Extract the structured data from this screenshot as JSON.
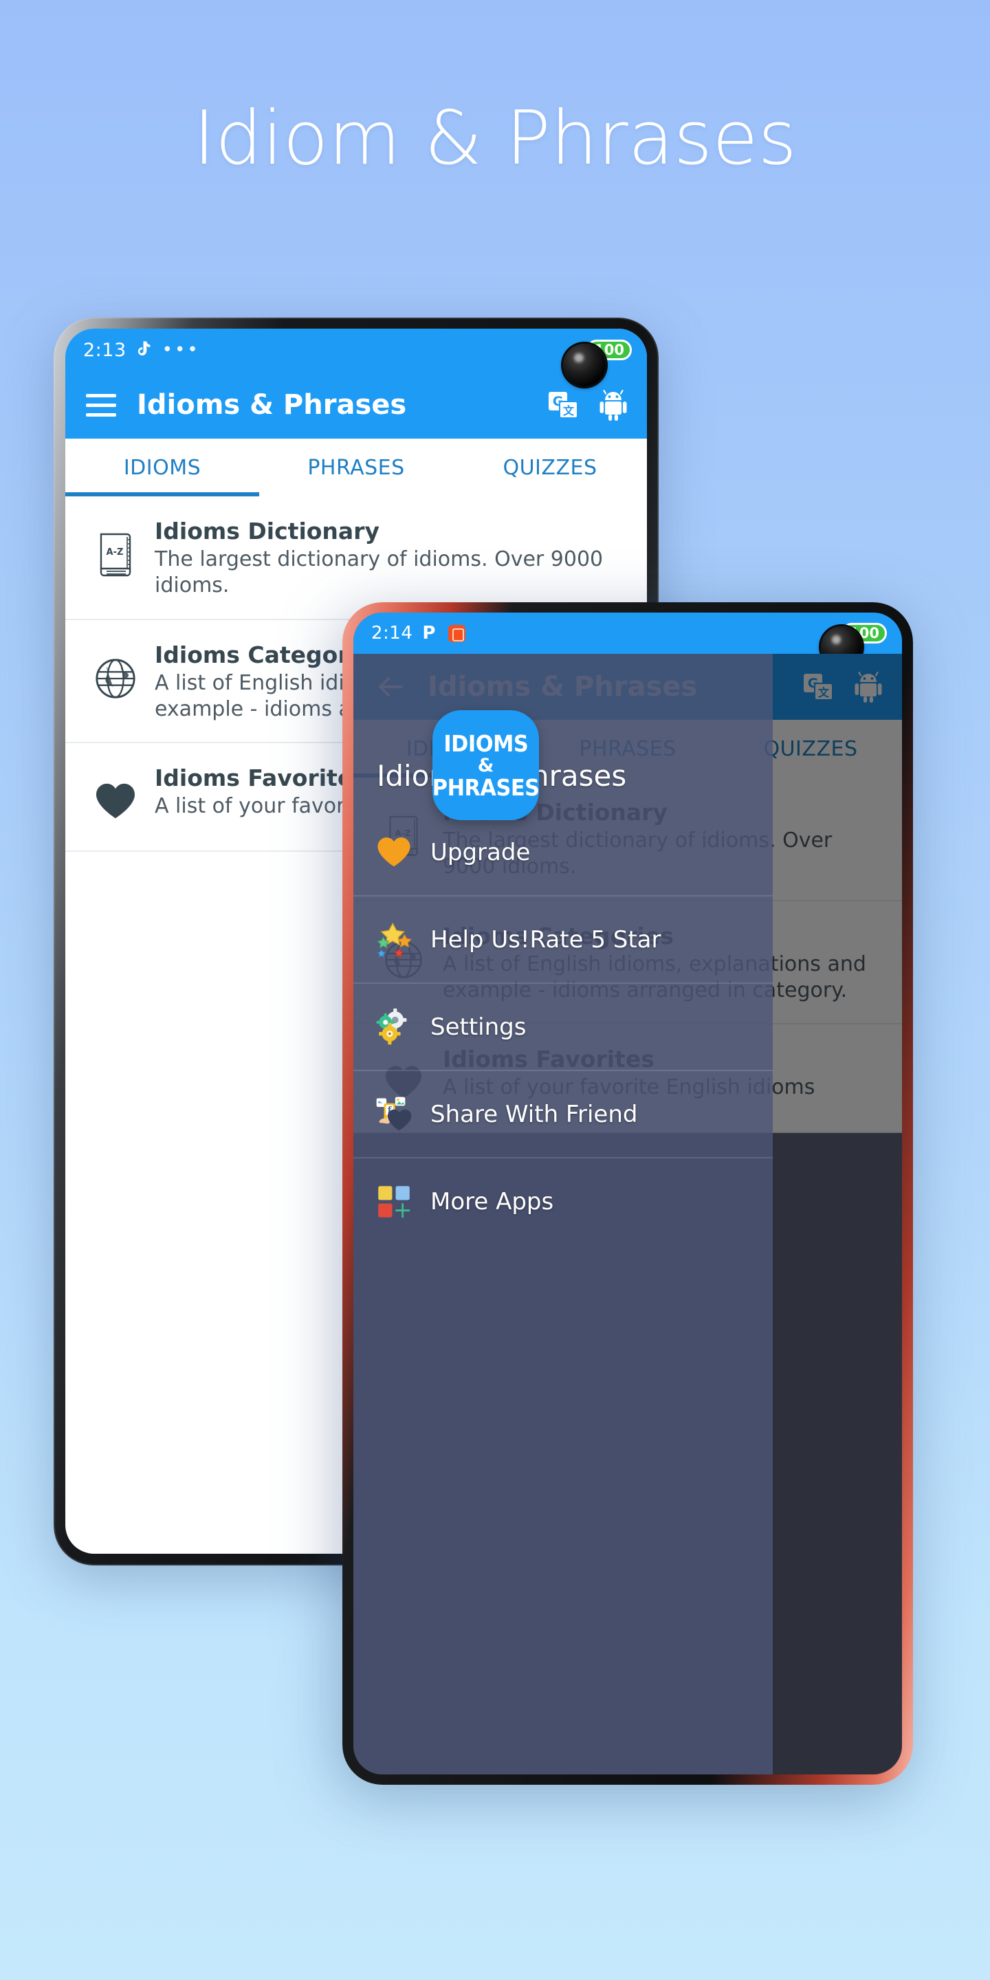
{
  "hero": {
    "title": "Idiom & Phrases"
  },
  "colors": {
    "bg_top": "#9cbffa",
    "bg_bottom": "#c5e8fc",
    "primary_blue": "#1e9bf5",
    "tab_blue": "#1e7fc4",
    "battery_green": "#3ec340",
    "accent_orange": "#f59f1e",
    "frame_front": "#c4422f",
    "frame_back": "#16181b"
  },
  "phone_back": {
    "status": {
      "time": "2:13",
      "icons": [
        "tiktok-icon",
        "more-dots-icon"
      ],
      "battery": "100"
    },
    "appbar": {
      "menu_icon": "hamburger-menu-icon",
      "title": "Idioms & Phrases",
      "actions": [
        "google-translate-icon",
        "android-robot-icon"
      ]
    },
    "tabs": [
      {
        "label": "IDIOMS",
        "selected": true
      },
      {
        "label": "PHRASES",
        "selected": false
      },
      {
        "label": "QUIZZES",
        "selected": false
      }
    ],
    "list": [
      {
        "icon": "az-dictionary-book-icon",
        "title": "Idioms Dictionary",
        "subtitle": "The largest dictionary of idioms. Over 9000 idioms."
      },
      {
        "icon": "globe-icon",
        "title": "Idioms Categories",
        "subtitle": "A list of English idioms, explanations and example - idioms arranged in category."
      },
      {
        "icon": "heart-icon",
        "title": "Idioms Favorites",
        "subtitle": "A list of your favorite English idioms"
      }
    ]
  },
  "phone_front": {
    "status": {
      "time": "2:14",
      "icons": [
        "pinterest-icon",
        "orange-app-icon"
      ],
      "battery": "100"
    },
    "appbar": {
      "back_icon": "back-arrow-icon",
      "title": "Idioms & Phrases",
      "actions": [
        "google-translate-icon",
        "android-robot-icon"
      ]
    },
    "tabs": [
      {
        "label": "IDIOMS",
        "selected": true
      },
      {
        "label": "PHRASES",
        "selected": false
      },
      {
        "label": "QUIZZES",
        "selected": false
      }
    ],
    "list": [
      {
        "icon": "az-dictionary-book-icon",
        "title": "Idioms Dictionary",
        "subtitle": "The largest dictionary of idioms. Over 9000 idioms."
      },
      {
        "icon": "globe-icon",
        "title": "Idioms Categories",
        "subtitle": "A list of English idioms, explanations and example - idioms arranged in category."
      },
      {
        "icon": "heart-icon",
        "title": "Idioms Favorites",
        "subtitle": "A list of your favorite English idioms"
      }
    ],
    "drawer": {
      "header_title": "Idioms & Phrases",
      "items": [
        {
          "icon": "orange-heart-icon",
          "label": "Upgrade"
        },
        {
          "icon": "stars-rating-icon",
          "label": "Help Us!Rate 5 Star"
        },
        {
          "icon": "settings-gears-icon",
          "label": "Settings"
        },
        {
          "icon": "share-phone-icon",
          "label": "Share With Friend"
        },
        {
          "icon": "more-apps-grid-icon",
          "label": "More Apps"
        }
      ]
    }
  },
  "app_badge": {
    "line1": "IDIOMS",
    "line2": "&",
    "line3": "PHRASES"
  }
}
